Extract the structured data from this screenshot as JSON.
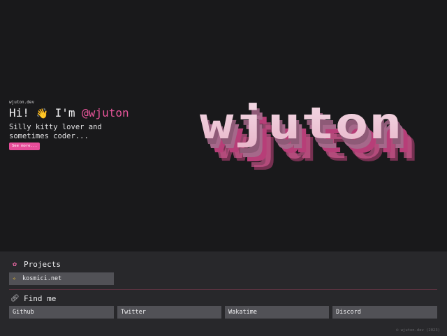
{
  "hero": {
    "site_label": "wjuton.dev",
    "greeting_prefix": "Hi!",
    "wave_emoji": "👋",
    "greeting_mid": "I'm",
    "handle": "@wjuton",
    "tagline": "Silly kitty lover and sometimes coder...",
    "see_more_label": "See more...",
    "logo_text": "wjuton"
  },
  "projects": {
    "heading": "Projects",
    "icon": "flower-icon",
    "items": [
      {
        "icon": "dizzy-star-icon",
        "label": "kosmici.net"
      }
    ]
  },
  "find_me": {
    "heading": "Find me",
    "icon": "link-icon",
    "links": [
      {
        "label": "Github"
      },
      {
        "label": "Twitter"
      },
      {
        "label": "Wakatime"
      },
      {
        "label": "Discord"
      }
    ]
  },
  "footer": "© wjuton.dev (2023)",
  "colors": {
    "background": "#19191b",
    "panel": "#28282b",
    "accent": "#e84d9a",
    "link_box": "#515156"
  }
}
